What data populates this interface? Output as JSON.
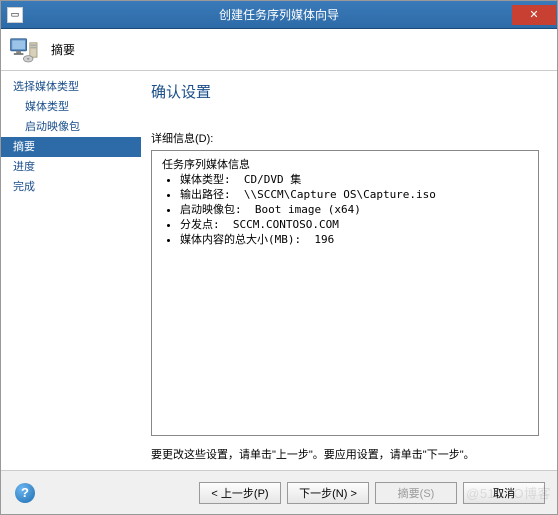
{
  "window": {
    "title": "创建任务序列媒体向导"
  },
  "header": {
    "text": "摘要"
  },
  "sidebar": {
    "items": [
      {
        "label": "选择媒体类型",
        "sub": false
      },
      {
        "label": "媒体类型",
        "sub": true
      },
      {
        "label": "启动映像包",
        "sub": true
      },
      {
        "label": "摘要",
        "sub": false,
        "selected": true
      },
      {
        "label": "进度",
        "sub": false
      },
      {
        "label": "完成",
        "sub": false
      }
    ]
  },
  "main": {
    "title": "确认设置",
    "details_label": "详细信息(D):",
    "section_title": "任务序列媒体信息",
    "lines": [
      "媒体类型:  CD/DVD 集",
      "输出路径:  \\\\SCCM\\Capture OS\\Capture.iso",
      "启动映像包:  Boot image (x64)",
      "分发点:  SCCM.CONTOSO.COM",
      "媒体内容的总大小(MB):  196"
    ],
    "hint": "要更改这些设置，请单击\"上一步\"。要应用设置，请单击\"下一步\"。"
  },
  "footer": {
    "prev": "< 上一步(P)",
    "next": "下一步(N) >",
    "summary": "摘要(S)",
    "cancel": "取消",
    "help": "?"
  },
  "watermark": "@51CTO博客"
}
